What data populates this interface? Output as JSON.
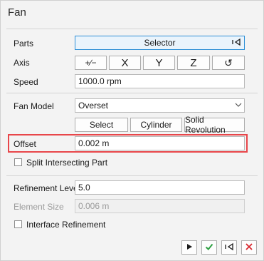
{
  "title": "Fan",
  "parts": {
    "label": "Parts",
    "value": "Selector"
  },
  "axis": {
    "label": "Axis",
    "buttons": [
      "+∕−",
      "X",
      "Y",
      "Z",
      "↺"
    ]
  },
  "speed": {
    "label": "Speed",
    "value": "1000.0 rpm"
  },
  "fan_model": {
    "label": "Fan Model",
    "value": "Overset"
  },
  "model_buttons": {
    "select": "Select",
    "cylinder": "Cylinder",
    "solid_revolution": "Solid Revolution"
  },
  "offset": {
    "label": "Offset",
    "value": "0.002 m"
  },
  "split_intersecting": {
    "label": "Split Intersecting Part",
    "checked": false
  },
  "refinement_level": {
    "label": "Refinement Level",
    "value": "5.0"
  },
  "element_size": {
    "label": "Element Size",
    "value": "0.006 m"
  },
  "interface_refinement": {
    "label": "Interface Refinement",
    "checked": false
  },
  "colors": {
    "accent": "#2e8fd6",
    "highlight": "#e8464a",
    "ok": "#2ea043",
    "cancel": "#d8282f"
  }
}
